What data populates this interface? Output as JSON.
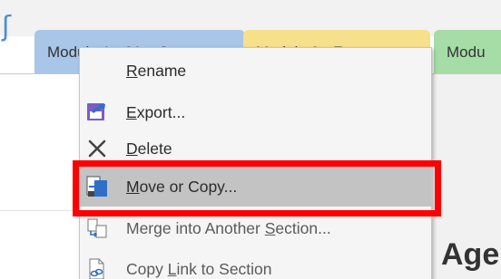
{
  "tabs": [
    {
      "label": "Module 1 - 21st Ce",
      "color": "#a9c5e7"
    },
    {
      "label": "Module 2 - F",
      "color": "#f6e08b"
    },
    {
      "label": "Modu",
      "color": "#a6dca6"
    }
  ],
  "page": {
    "heading_fragment": "Agen"
  },
  "context_menu": {
    "items": [
      {
        "pre": "",
        "u": "R",
        "post": "ename",
        "icon": "none"
      },
      {
        "pre": "",
        "u": "E",
        "post": "xport...",
        "icon": "export-icon"
      },
      {
        "pre": "",
        "u": "D",
        "post": "elete",
        "icon": "close-x-icon"
      },
      {
        "pre": "",
        "u": "M",
        "post": "ove or Copy...",
        "icon": "move-copy-icon",
        "state": "selected"
      },
      {
        "pre": "Merge into Another ",
        "u": "S",
        "post": "ection...",
        "icon": "merge-icon"
      },
      {
        "pre": "Copy ",
        "u": "L",
        "post": "ink to Section",
        "icon": "copy-link-icon"
      }
    ]
  },
  "annotation": {
    "highlight_color": "#ff0000",
    "target": "Move or Copy..."
  }
}
